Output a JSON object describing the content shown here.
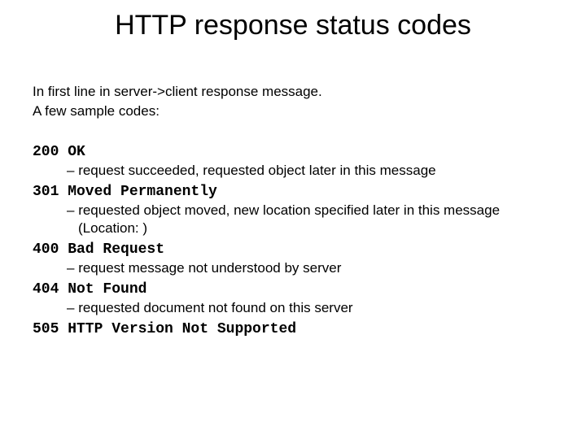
{
  "title": "HTTP response status codes",
  "intro_line1": "In first line in server->client response message.",
  "intro_line2": "A few sample codes:",
  "codes": [
    {
      "status": "200 OK",
      "desc": "request succeeded, requested object later in this message"
    },
    {
      "status": "301 Moved Permanently",
      "desc": "requested object moved, new location specified later in this message (Location: )"
    },
    {
      "status": "400 Bad Request",
      "desc": "request message not understood by server"
    },
    {
      "status": "404 Not Found",
      "desc": "requested document not found on this server"
    },
    {
      "status": "505 HTTP Version Not Supported",
      "desc": ""
    }
  ]
}
